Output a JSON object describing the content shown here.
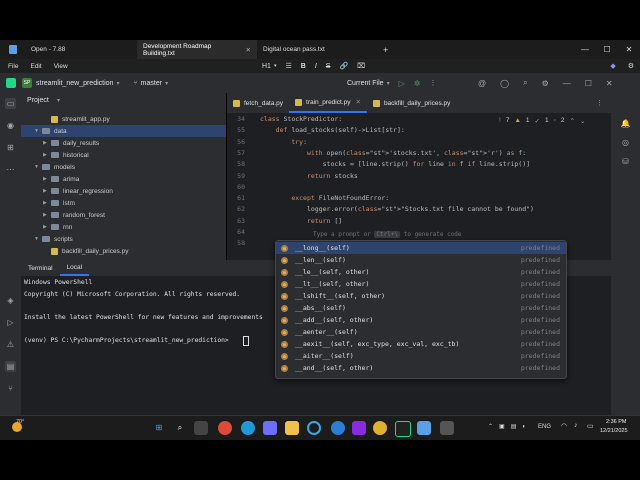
{
  "notepad": {
    "tabs": [
      {
        "label": "Open - 7.88",
        "active": false
      },
      {
        "label": "Development Roadmap Building.txt",
        "active": true
      },
      {
        "label": "Digital ocean pass.txt",
        "active": false
      }
    ],
    "new_tab": "+",
    "menu": [
      "File",
      "Edit",
      "View"
    ],
    "format": {
      "heading": "H1",
      "bold": "B",
      "italic": "I",
      "strikethrough": "S"
    },
    "window_controls": {
      "minimize": "—",
      "maximize": "☐",
      "close": "✕"
    }
  },
  "pycharm": {
    "project_badge": "SP",
    "project_name": "streamlit_new_prediction",
    "branch": "master",
    "run_config": "Current File",
    "project_panel_title": "Project",
    "tree": [
      {
        "label": "streamlit_app.py",
        "type": "file",
        "level": 2,
        "expanded": false
      },
      {
        "label": "data",
        "type": "folder",
        "level": 1,
        "expanded": true,
        "selected": true
      },
      {
        "label": "daily_results",
        "type": "folder",
        "level": 2,
        "expanded": false
      },
      {
        "label": "historical",
        "type": "folder",
        "level": 2,
        "expanded": false
      },
      {
        "label": "models",
        "type": "folder",
        "level": 1,
        "expanded": true
      },
      {
        "label": "arima",
        "type": "folder",
        "level": 2,
        "expanded": false
      },
      {
        "label": "linear_regression",
        "type": "folder",
        "level": 2,
        "expanded": false
      },
      {
        "label": "lstm",
        "type": "folder",
        "level": 2,
        "expanded": false
      },
      {
        "label": "random_forest",
        "type": "folder",
        "level": 2,
        "expanded": false
      },
      {
        "label": "rnn",
        "type": "folder",
        "level": 2,
        "expanded": false
      },
      {
        "label": "scripts",
        "type": "folder",
        "level": 1,
        "expanded": true
      },
      {
        "label": "backfill_daily_prices.py",
        "type": "file",
        "level": 2,
        "expanded": false
      }
    ],
    "editor_tabs": [
      {
        "label": "fetch_data.py",
        "active": false
      },
      {
        "label": "train_predict.py",
        "active": true
      },
      {
        "label": "backfill_daily_prices.py",
        "active": false
      }
    ],
    "inspections": {
      "warnings": "7",
      "weak": "1",
      "typos": "1",
      "info": "2"
    },
    "code_lines": [
      {
        "num": "34",
        "text": "class StockPredictor:"
      },
      {
        "num": "55",
        "text": "    def load_stocks(self)->List[str]:"
      },
      {
        "num": "56",
        "text": "        try:"
      },
      {
        "num": "57",
        "text": "            with open('stocks.txt', 'r') as f:"
      },
      {
        "num": "58",
        "text": "                stocks = [line.strip() for line in f if line.strip()]"
      },
      {
        "num": "59",
        "text": "            return stocks"
      },
      {
        "num": "60",
        "text": ""
      },
      {
        "num": "61",
        "text": "        except FileNotFoundError:"
      },
      {
        "num": "62",
        "text": "            logger.error(\"Stocks.txt file cannot be found\")"
      },
      {
        "num": "63",
        "text": "            return []"
      },
      {
        "num": "64",
        "text": ""
      },
      {
        "num": "58",
        "text": "    def l"
      }
    ],
    "inline_hint": "Type a prompt or",
    "inline_hint_key": "Ctrl+\\",
    "inline_hint_tail": "to generate code",
    "terminal": {
      "tabs": [
        "Terminal",
        "Local"
      ],
      "lines": [
        "Windows PowerShell",
        "Copyright (C) Microsoft Corporation. All rights reserved.",
        "",
        "Install the latest PowerShell for new features and improvements",
        "",
        "(venv) PS C:\\PycharmProjects\\streamlit_new_prediction> "
      ]
    },
    "completion": [
      {
        "name": "__long__(self)",
        "type": "predefined"
      },
      {
        "name": "__len__(self)",
        "type": "predefined"
      },
      {
        "name": "__le__(self, other)",
        "type": "predefined"
      },
      {
        "name": "__lt__(self, other)",
        "type": "predefined"
      },
      {
        "name": "__lshift__(self, other)",
        "type": "predefined"
      },
      {
        "name": "__abs__(self)",
        "type": "predefined"
      },
      {
        "name": "__add__(self, other)",
        "type": "predefined"
      },
      {
        "name": "__aenter__(self)",
        "type": "predefined"
      },
      {
        "name": "__aexit__(self, exc_type, exc_val, exc_tb)",
        "type": "predefined"
      },
      {
        "name": "__aiter__(self)",
        "type": "predefined"
      },
      {
        "name": "__and__(self, other)",
        "type": "predefined"
      }
    ]
  },
  "taskbar": {
    "weather": "70°",
    "lang": "ENG",
    "time": "2:36 PM",
    "date": "12/21/2025"
  }
}
